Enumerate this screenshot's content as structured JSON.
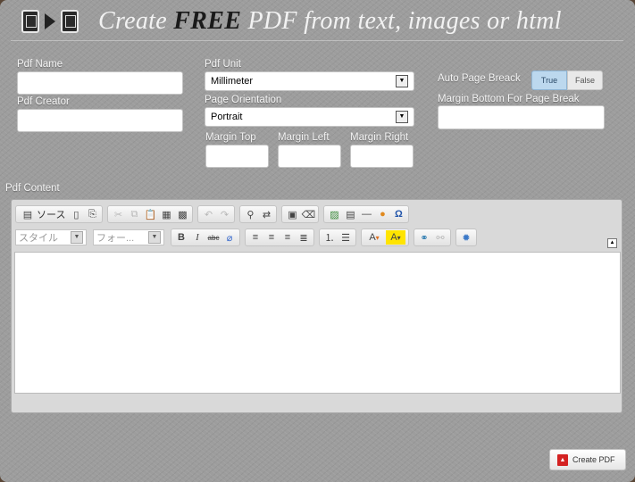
{
  "header": {
    "title_pre": "Create ",
    "title_em": "FREE",
    "title_post": " PDF from text, images or html"
  },
  "form": {
    "pdf_name_label": "Pdf Name",
    "pdf_name_value": "",
    "pdf_creator_label": "Pdf Creator",
    "pdf_creator_value": "",
    "pdf_unit_label": "Pdf Unit",
    "pdf_unit_value": "Millimeter",
    "orientation_label": "Page Orientation",
    "orientation_value": "Portrait",
    "margin_top_label": "Margin Top",
    "margin_left_label": "Margin Left",
    "margin_right_label": "Margin Right",
    "auto_break_label": "Auto Page Breack",
    "auto_break_true": "True",
    "auto_break_false": "False",
    "auto_break_selected": "True",
    "margin_bottom_label": "Margin Bottom For Page Break",
    "content_label": "Pdf Content"
  },
  "editor": {
    "source_label": "ソース",
    "style_placeholder": "スタイル",
    "format_placeholder": "フォー..."
  },
  "actions": {
    "create_pdf": "Create PDF"
  },
  "colors": {
    "accent_true": "#bcd8ee",
    "pdf_red": "#d42222"
  }
}
